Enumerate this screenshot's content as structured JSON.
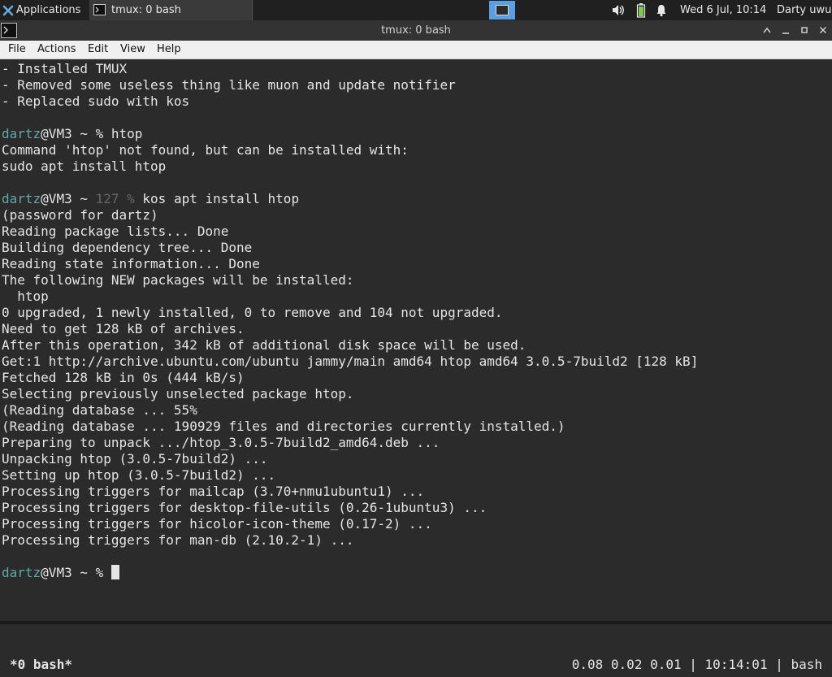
{
  "panel": {
    "applications_label": "Applications",
    "task_label": "tmux: 0 bash",
    "datetime": "Wed  6 Jul, 10:14",
    "user": "Darty uwu",
    "icons": [
      "xfce-icon",
      "terminal-icon",
      "workspace-icon",
      "volume-icon",
      "battery-icon",
      "notification-bell-icon"
    ]
  },
  "window": {
    "title": "tmux: 0 bash",
    "controls": [
      "minimize",
      "maximize",
      "close"
    ]
  },
  "menubar": {
    "items": [
      "File",
      "Actions",
      "Edit",
      "View",
      "Help"
    ]
  },
  "terminal": {
    "lines": [
      {
        "text": "- Installed TMUX"
      },
      {
        "text": "- Removed some useless thing like muon and update notifier"
      },
      {
        "text": "- Replaced sudo with kos"
      },
      {
        "text": ""
      },
      {
        "user": "dartz",
        "host": "@VM3",
        "path": " ~ ",
        "status": "",
        "cmd": "% htop"
      },
      {
        "text": "Command 'htop' not found, but can be installed with:"
      },
      {
        "text": "sudo apt install htop"
      },
      {
        "text": ""
      },
      {
        "user": "dartz",
        "host": "@VM3",
        "path": " ~ ",
        "status": "127 %",
        "cmd": " kos apt install htop"
      },
      {
        "text": "(password for dartz)"
      },
      {
        "text": "Reading package lists... Done"
      },
      {
        "text": "Building dependency tree... Done"
      },
      {
        "text": "Reading state information... Done"
      },
      {
        "text": "The following NEW packages will be installed:"
      },
      {
        "text": "  htop"
      },
      {
        "text": "0 upgraded, 1 newly installed, 0 to remove and 104 not upgraded."
      },
      {
        "text": "Need to get 128 kB of archives."
      },
      {
        "text": "After this operation, 342 kB of additional disk space will be used."
      },
      {
        "text": "Get:1 http://archive.ubuntu.com/ubuntu jammy/main amd64 htop amd64 3.0.5-7build2 [128 kB]"
      },
      {
        "text": "Fetched 128 kB in 0s (444 kB/s)"
      },
      {
        "text": "Selecting previously unselected package htop."
      },
      {
        "text": "(Reading database ... 55%"
      },
      {
        "text": "(Reading database ... 190929 files and directories currently installed.)"
      },
      {
        "text": "Preparing to unpack .../htop_3.0.5-7build2_amd64.deb ..."
      },
      {
        "text": "Unpacking htop (3.0.5-7build2) ..."
      },
      {
        "text": "Setting up htop (3.0.5-7build2) ..."
      },
      {
        "text": "Processing triggers for mailcap (3.70+nmu1ubuntu1) ..."
      },
      {
        "text": "Processing triggers for desktop-file-utils (0.26-1ubuntu3) ..."
      },
      {
        "text": "Processing triggers for hicolor-icon-theme (0.17-2) ..."
      },
      {
        "text": "Processing triggers for man-db (2.10.2-1) ..."
      },
      {
        "text": ""
      },
      {
        "user": "dartz",
        "host": "@VM3",
        "path": " ~ ",
        "status": "",
        "cmd": "% "
      }
    ]
  },
  "tmux": {
    "window_label": "*0 bash*",
    "status_right": "0.08 0.02 0.01 | 10:14:01 | bash"
  }
}
